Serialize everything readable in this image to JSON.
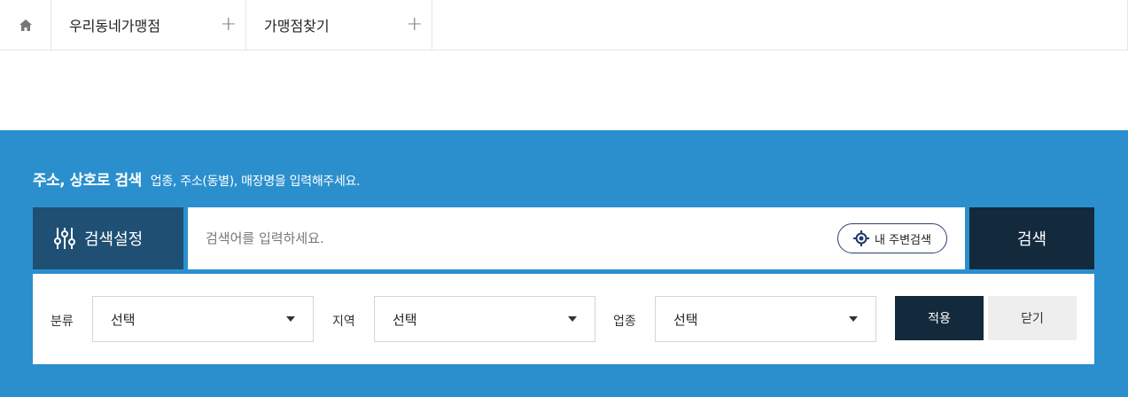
{
  "tabs": {
    "home_icon": "home-icon",
    "items": [
      {
        "label": "우리동네가맹점",
        "action_icon": "plus"
      },
      {
        "label": "가맹점찾기",
        "action_icon": "plus"
      }
    ]
  },
  "search": {
    "title": "주소, 상호로 검색",
    "subtitle": "업종, 주소(동별), 매장명을 입력해주세요.",
    "settings_label": "검색설정",
    "placeholder": "검색어를 입력하세요.",
    "value": "",
    "nearby_label": "내 주변검색",
    "submit_label": "검색"
  },
  "filters": {
    "category": {
      "label": "분류",
      "selected": "선택"
    },
    "region": {
      "label": "지역",
      "selected": "선택"
    },
    "business": {
      "label": "업종",
      "selected": "선택"
    },
    "apply_label": "적용",
    "close_label": "닫기"
  },
  "colors": {
    "panel_bg": "#2b8fce",
    "settings_bg": "#1f4f73",
    "dark_button": "#132a3d",
    "light_button": "#eeeeee"
  }
}
